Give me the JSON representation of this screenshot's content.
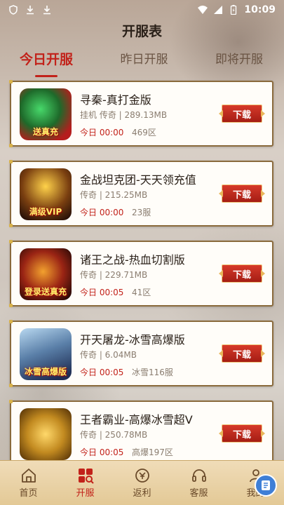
{
  "status_bar": {
    "time": "10:09"
  },
  "header": {
    "title": "开服表"
  },
  "tabs": [
    {
      "label": "今日开服",
      "active": true
    },
    {
      "label": "昨日开服",
      "active": false
    },
    {
      "label": "即将开服",
      "active": false
    }
  ],
  "games": [
    {
      "name": "寻秦-真打金版",
      "meta": "挂机 传奇 | 289.13MB",
      "time": "今日 00:00",
      "server": "469区",
      "badge": "送真充",
      "button": "下载"
    },
    {
      "name": "金战坦克团-天天领充值",
      "meta": "传奇 | 215.25MB",
      "time": "今日 00:00",
      "server": "23服",
      "badge": "满级VIP",
      "button": "下载"
    },
    {
      "name": "诸王之战-热血切割版",
      "meta": "传奇 | 229.71MB",
      "time": "今日 00:05",
      "server": "41区",
      "badge": "登录送真充",
      "button": "下载"
    },
    {
      "name": "开天屠龙-冰雪高爆版",
      "meta": "传奇 | 6.04MB",
      "time": "今日 00:05",
      "server": "冰雪116服",
      "badge": "冰雪高爆版",
      "button": "下载"
    },
    {
      "name": "王者霸业-高爆冰雪超V",
      "meta": "传奇 | 250.78MB",
      "time": "今日 00:05",
      "server": "高爆197区",
      "badge": "",
      "button": "下载"
    }
  ],
  "bottom_nav": [
    {
      "label": "首页",
      "icon": "home-icon",
      "active": false
    },
    {
      "label": "开服",
      "icon": "server-list-icon",
      "active": true
    },
    {
      "label": "返利",
      "icon": "rebate-icon",
      "active": false
    },
    {
      "label": "客服",
      "icon": "headset-icon",
      "active": false
    },
    {
      "label": "我的",
      "icon": "profile-icon",
      "active": false
    }
  ],
  "colors": {
    "accent": "#c2221a",
    "card_border": "#8a6a3c",
    "nav_bg": "#f0dcb8"
  }
}
